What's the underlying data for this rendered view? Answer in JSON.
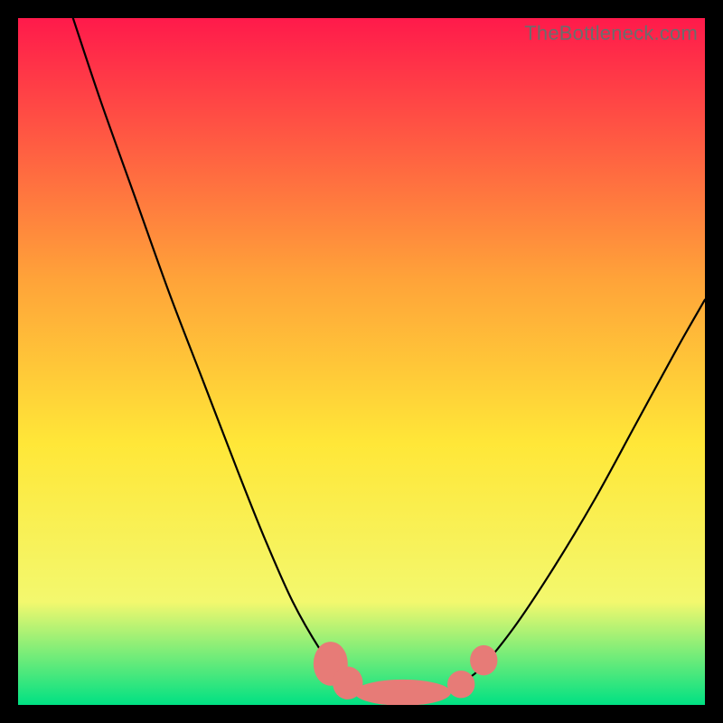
{
  "watermark": "TheBottleneck.com",
  "chart_data": {
    "type": "line",
    "title": "",
    "xlabel": "",
    "ylabel": "",
    "xlim": [
      0,
      100
    ],
    "ylim": [
      0,
      100
    ],
    "annotations": [],
    "background_gradient": {
      "top": "#ff1a4b",
      "upper_mid": "#ffa339",
      "mid": "#ffe738",
      "lower_mid": "#f3f86e",
      "bottom": "#00e183"
    },
    "series": [
      {
        "name": "left-curve",
        "stroke": "#000000",
        "points": [
          {
            "x": 8,
            "y": 100
          },
          {
            "x": 12,
            "y": 88
          },
          {
            "x": 17,
            "y": 74
          },
          {
            "x": 22,
            "y": 60
          },
          {
            "x": 27,
            "y": 47
          },
          {
            "x": 32,
            "y": 34
          },
          {
            "x": 36,
            "y": 24
          },
          {
            "x": 40,
            "y": 15
          },
          {
            "x": 44,
            "y": 8
          },
          {
            "x": 47,
            "y": 4
          },
          {
            "x": 50,
            "y": 2
          }
        ]
      },
      {
        "name": "valley-floor",
        "stroke": "#000000",
        "points": [
          {
            "x": 50,
            "y": 2
          },
          {
            "x": 53,
            "y": 1.5
          },
          {
            "x": 56,
            "y": 1.5
          },
          {
            "x": 60,
            "y": 1.7
          },
          {
            "x": 63,
            "y": 2.3
          }
        ]
      },
      {
        "name": "right-curve",
        "stroke": "#000000",
        "points": [
          {
            "x": 63,
            "y": 2.3
          },
          {
            "x": 67,
            "y": 5
          },
          {
            "x": 72,
            "y": 11
          },
          {
            "x": 78,
            "y": 20
          },
          {
            "x": 84,
            "y": 30
          },
          {
            "x": 90,
            "y": 41
          },
          {
            "x": 96,
            "y": 52
          },
          {
            "x": 100,
            "y": 59
          }
        ]
      }
    ],
    "markers": [
      {
        "x": 45.5,
        "y": 6.0,
        "rx": 2.5,
        "ry": 3.2,
        "fill": "#e77b77"
      },
      {
        "x": 48.0,
        "y": 3.2,
        "rx": 2.2,
        "ry": 2.4,
        "fill": "#e77b77"
      },
      {
        "x": 56.0,
        "y": 1.8,
        "rx": 7.0,
        "ry": 1.9,
        "fill": "#e77b77"
      },
      {
        "x": 64.5,
        "y": 3.0,
        "rx": 2.0,
        "ry": 2.0,
        "fill": "#e77b77"
      },
      {
        "x": 67.8,
        "y": 6.5,
        "rx": 2.0,
        "ry": 2.2,
        "fill": "#e77b77"
      }
    ]
  }
}
